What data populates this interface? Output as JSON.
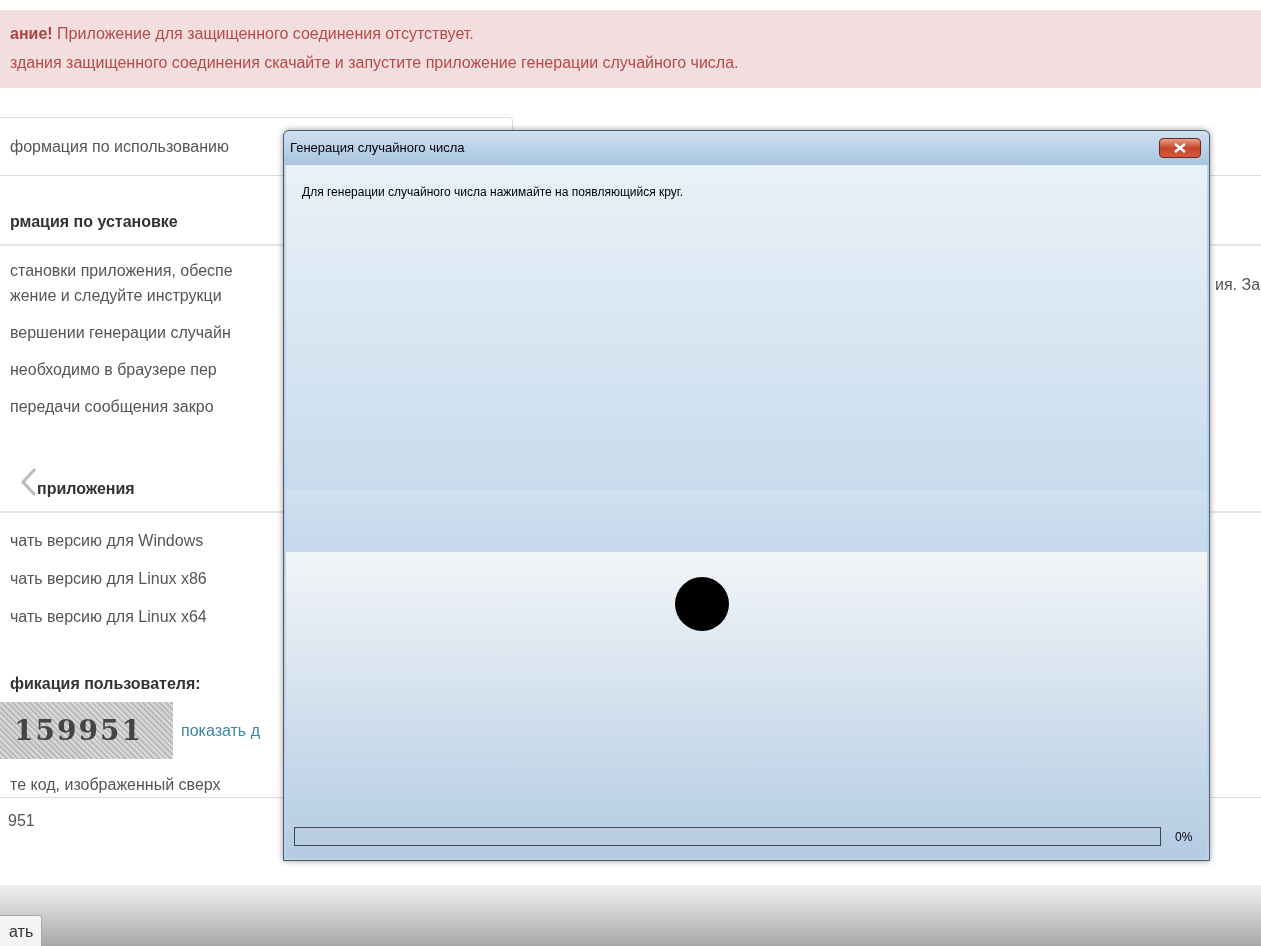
{
  "alert": {
    "lines": [
      "**ание!** Приложение для защищенного соединения отсутствует.",
      "здания защищенного соединения скачайте и запустите приложение генерации случайного числа."
    ]
  },
  "usage_tab": {
    "label": "формация по использованию"
  },
  "install_section": {
    "heading": "рмация по установке",
    "paragraphs": [
      [
        "становки приложения, обеспе",
        "жение и следуйте инструкци"
      ],
      [
        "вершении генерации случайн"
      ],
      [
        "необходимо в браузере пер"
      ],
      [
        "передачи сообщения закро"
      ]
    ],
    "right_fragment": "ия. За"
  },
  "downloads_section": {
    "heading": "приложения",
    "links": [
      "чать версию для Windows",
      "чать версию для Linux x86",
      "чать версию для Linux x64"
    ]
  },
  "verification": {
    "heading": "фикация пользователя:",
    "captcha": "159951",
    "link": "показать д",
    "hint": "те код, изображенный сверх",
    "value": "951"
  },
  "submit_button": {
    "label": "ать"
  },
  "dialog": {
    "title": "Генерация случайного числа",
    "instruction": "Для генерации случайного числа нажимайте на появляющийся круг.",
    "progress": {
      "level": 0,
      "reading": "0%"
    }
  }
}
